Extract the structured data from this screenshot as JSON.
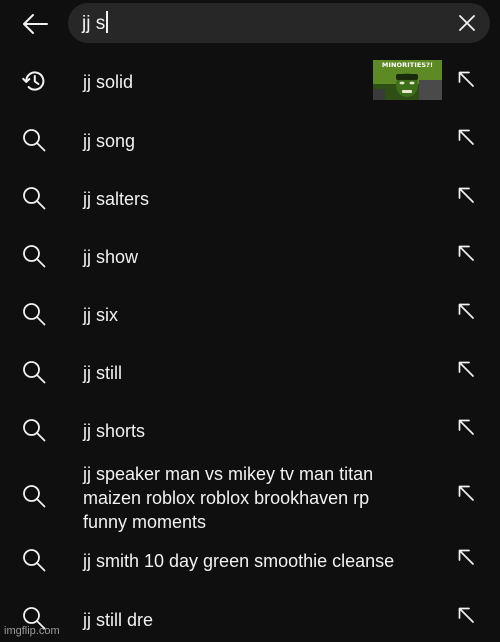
{
  "search": {
    "query": "jj s"
  },
  "icons": {
    "back": "arrow-left-icon",
    "clear": "close-icon",
    "history": "history-icon",
    "search": "search-icon",
    "fill": "arrow-up-left-icon"
  },
  "colors": {
    "background": "#0f0f0f",
    "search_box": "#272727",
    "text": "#f1f1f1",
    "icon": "#f1f1f1"
  },
  "suggestions": [
    {
      "text": "jj solid",
      "type": "history",
      "has_thumbnail": true
    },
    {
      "text": "jj song",
      "type": "search"
    },
    {
      "text": "jj salters",
      "type": "search"
    },
    {
      "text": "jj show",
      "type": "search"
    },
    {
      "text": "jj six",
      "type": "search"
    },
    {
      "text": "jj still",
      "type": "search"
    },
    {
      "text": "jj shorts",
      "type": "search"
    },
    {
      "text": "jj speaker man vs mikey tv man titan",
      "line2": "maizen roblox roblox brookhaven rp",
      "line3": "funny moments",
      "type": "search"
    },
    {
      "text": "jj smith 10 day green smoothie cleanse",
      "type": "search"
    },
    {
      "text": "jj still dre",
      "type": "search"
    }
  ],
  "thumbnail": {
    "caption": "MINORITIES?!"
  },
  "watermark": "imgflip.com"
}
